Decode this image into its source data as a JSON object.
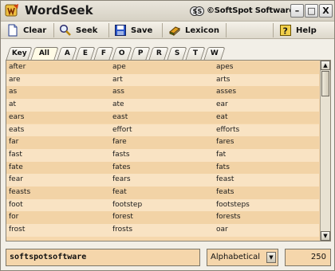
{
  "window": {
    "title": "WordSeek",
    "brand": "©SoftSpot Software"
  },
  "window_controls": {
    "minimize": "–",
    "maximize": "□",
    "close": "X"
  },
  "toolbar": {
    "clear": "Clear",
    "seek": "Seek",
    "save": "Save",
    "lexicon": "Lexicon",
    "help": "Help"
  },
  "tabs": [
    "Key",
    "All",
    "A",
    "E",
    "F",
    "O",
    "P",
    "R",
    "S",
    "T",
    "W"
  ],
  "active_tab": "All",
  "rows": [
    [
      "after",
      "ape",
      "apes"
    ],
    [
      "are",
      "art",
      "arts"
    ],
    [
      "as",
      "ass",
      "asses"
    ],
    [
      "at",
      "ate",
      "ear"
    ],
    [
      "ears",
      "east",
      "eat"
    ],
    [
      "eats",
      "effort",
      "efforts"
    ],
    [
      "far",
      "fare",
      "fares"
    ],
    [
      "fast",
      "fasts",
      "fat"
    ],
    [
      "fate",
      "fates",
      "fats"
    ],
    [
      "fear",
      "fears",
      "feast"
    ],
    [
      "feasts",
      "feat",
      "feats"
    ],
    [
      "foot",
      "footstep",
      "footsteps"
    ],
    [
      "for",
      "forest",
      "forests"
    ],
    [
      "frost",
      "frosts",
      "oar"
    ]
  ],
  "search": {
    "value": "softspotsoftware"
  },
  "sort": {
    "selected": "Alphabetical"
  },
  "count": "250",
  "colors": {
    "list_bg": "#f6d8ad",
    "accent": "#f5d6ab"
  },
  "icons": {
    "app": "wordseek-logo-icon",
    "clear": "document-icon",
    "seek": "magnifier-icon",
    "save": "floppy-disk-icon",
    "lexicon": "book-icon",
    "help": "question-icon"
  }
}
